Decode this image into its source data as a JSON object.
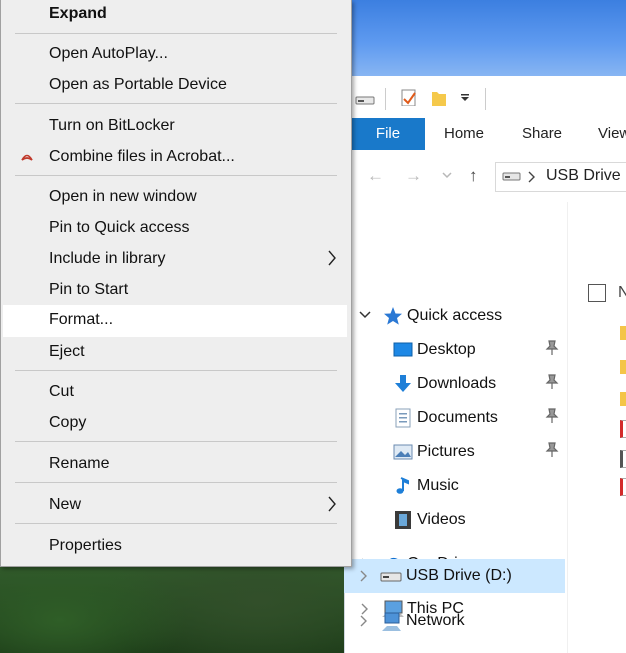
{
  "context_menu": {
    "items": [
      {
        "label": "Expand"
      },
      {
        "label": "Open AutoPlay..."
      },
      {
        "label": "Open as Portable Device"
      },
      {
        "label": "Turn on BitLocker"
      },
      {
        "label": "Combine files in Acrobat..."
      },
      {
        "label": "Open in new window"
      },
      {
        "label": "Pin to Quick access"
      },
      {
        "label": "Include in library"
      },
      {
        "label": "Pin to Start"
      },
      {
        "label": "Format..."
      },
      {
        "label": "Eject"
      },
      {
        "label": "Cut"
      },
      {
        "label": "Copy"
      },
      {
        "label": "Rename"
      },
      {
        "label": "New"
      },
      {
        "label": "Properties"
      }
    ],
    "highlighted_item": "Format..."
  },
  "explorer": {
    "ribbon_tabs": [
      "File",
      "Home",
      "Share",
      "View"
    ],
    "address": "USB Drive (",
    "nav": {
      "quick_access": "Quick access",
      "desktop": "Desktop",
      "downloads": "Downloads",
      "documents": "Documents",
      "pictures": "Pictures",
      "music": "Music",
      "videos": "Videos",
      "onedrive": "OneDrive",
      "this_pc": "This PC",
      "usb_drive": "USB Drive (D:)",
      "network": "Network"
    },
    "selected_nav_item": "USB Drive (D:)",
    "column_header_partial": "N"
  },
  "colors": {
    "file_tab": "#1979ca",
    "selection": "#cce8ff",
    "menu_bg": "#eeeeee"
  }
}
